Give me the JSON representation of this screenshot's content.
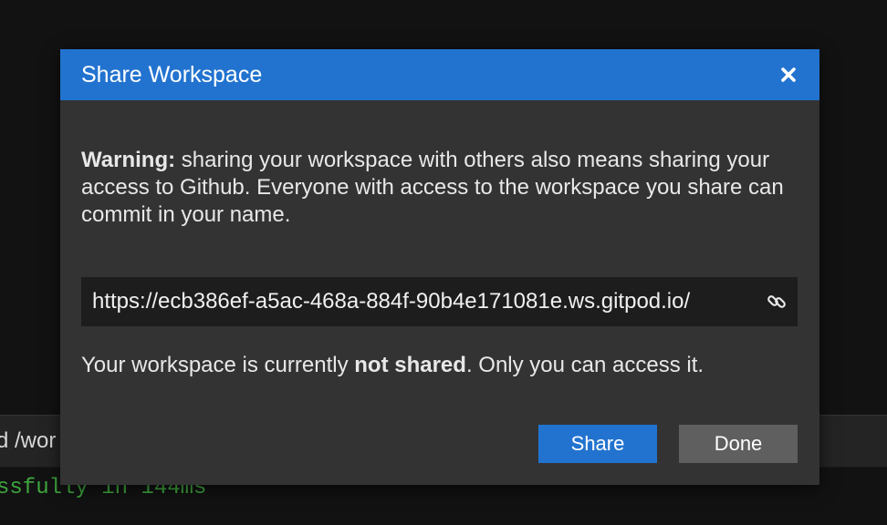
{
  "background": {
    "path_fragment": "d /wor",
    "terminal_fragment": "ssfully in 144ms"
  },
  "dialog": {
    "title": "Share Workspace",
    "close_icon": "close-icon",
    "warning_label": "Warning:",
    "warning_text": " sharing your workspace with others also means sharing your access to Github. Everyone with access to the workspace you share can commit in your name.",
    "url": "https://ecb386ef-a5ac-468a-884f-90b4e171081e.ws.gitpod.io/",
    "link_icon": "link-icon",
    "status_prefix": "Your workspace is currently ",
    "status_bold": "not shared",
    "status_suffix": ". Only you can access it.",
    "share_label": "Share",
    "done_label": "Done"
  },
  "colors": {
    "accent": "#2273cf",
    "dialog_bg": "#333333",
    "url_bg": "#1d1d1d",
    "done_bg": "#5f5f5f"
  }
}
